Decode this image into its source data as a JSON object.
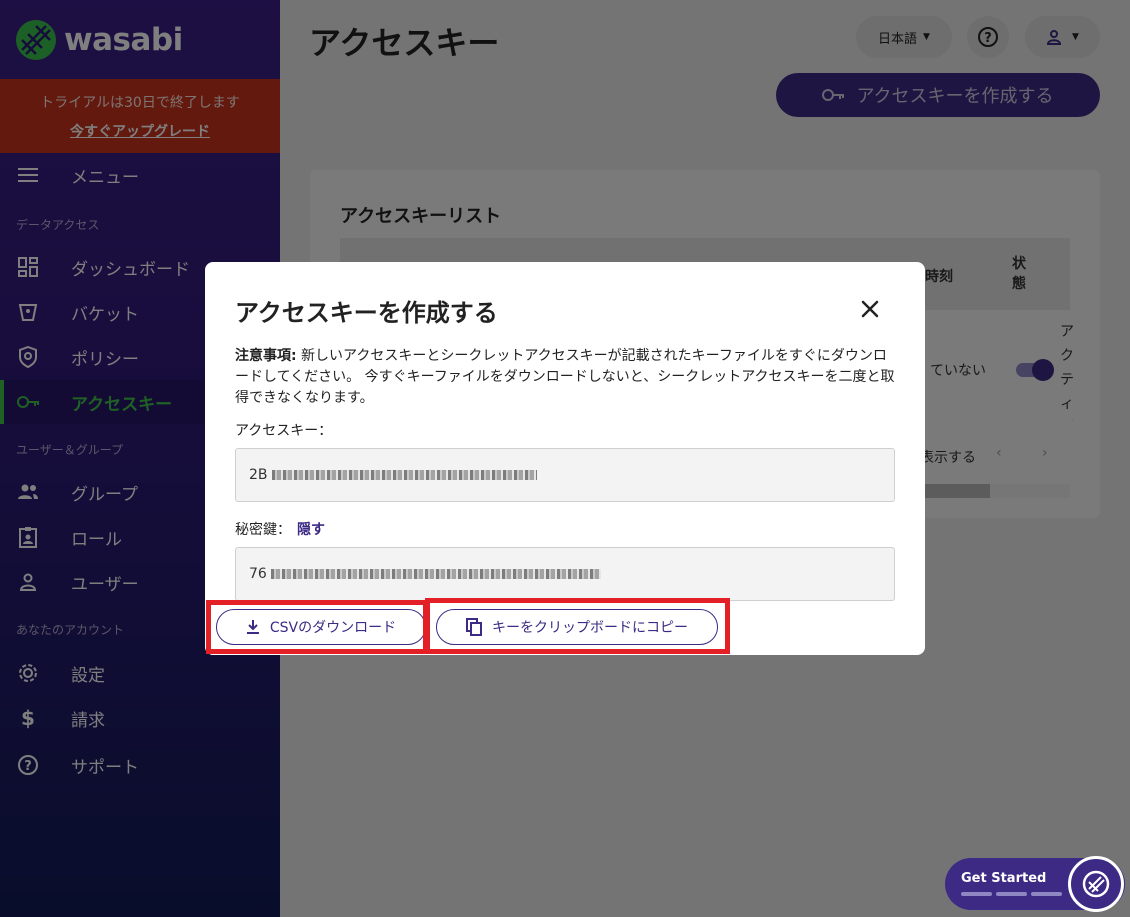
{
  "app": {
    "logo_text": "wasabi"
  },
  "trial": {
    "message": "トライアルは30日で終了します",
    "upgrade_link": "今すぐアップグレード"
  },
  "sidebar": {
    "menu_label": "メニュー",
    "sections": [
      "データアクセス",
      "ユーザー＆グループ",
      "あなたのアカウント"
    ],
    "items": [
      {
        "label": "ダッシュボード",
        "icon": "dashboard-icon"
      },
      {
        "label": "バケット",
        "icon": "bucket-icon"
      },
      {
        "label": "ポリシー",
        "icon": "policy-shield-icon"
      },
      {
        "label": "アクセスキー",
        "icon": "key-icon",
        "active": true
      },
      {
        "label": "グループ",
        "icon": "group-icon"
      },
      {
        "label": "ロール",
        "icon": "role-badge-icon"
      },
      {
        "label": "ユーザー",
        "icon": "user-icon"
      },
      {
        "label": "設定",
        "icon": "gear-icon"
      },
      {
        "label": "請求",
        "icon": "dollar-icon"
      },
      {
        "label": "サポート",
        "icon": "help-icon"
      }
    ]
  },
  "header": {
    "title": "アクセスキー",
    "language": "日本語",
    "create_button": "アクセスキーを作成する"
  },
  "panel": {
    "title": "アクセスキーリスト",
    "col_time": "時刻",
    "col_status": "状態",
    "cell_status_text": "ていない",
    "cell_side_text": "アクティブ",
    "pagination_text": "表示する"
  },
  "modal": {
    "title": "アクセスキーを作成する",
    "notice_bold": "注意事項:",
    "notice_text": " 新しいアクセスキーとシークレットアクセスキーが記載されたキーファイルをすぐにダウンロードしてください。 今すぐキーファイルをダウンロードしないと、シークレットアクセスキーを二度と取得できなくなります。",
    "access_key_label": "アクセスキー：",
    "access_key_value": "2B",
    "secret_key_label": "秘密鍵：",
    "hide_link": "隠す",
    "secret_key_value": "76",
    "download_button": "CSVのダウンロード",
    "copy_button": "キーをクリップボードにコピー"
  },
  "get_started": {
    "label": "Get Started"
  },
  "colors": {
    "sidebar": "#2e1a78",
    "accent": "#3c2a85",
    "active": "#3ec24a",
    "trial": "#c7321b",
    "highlight": "#e32026"
  }
}
